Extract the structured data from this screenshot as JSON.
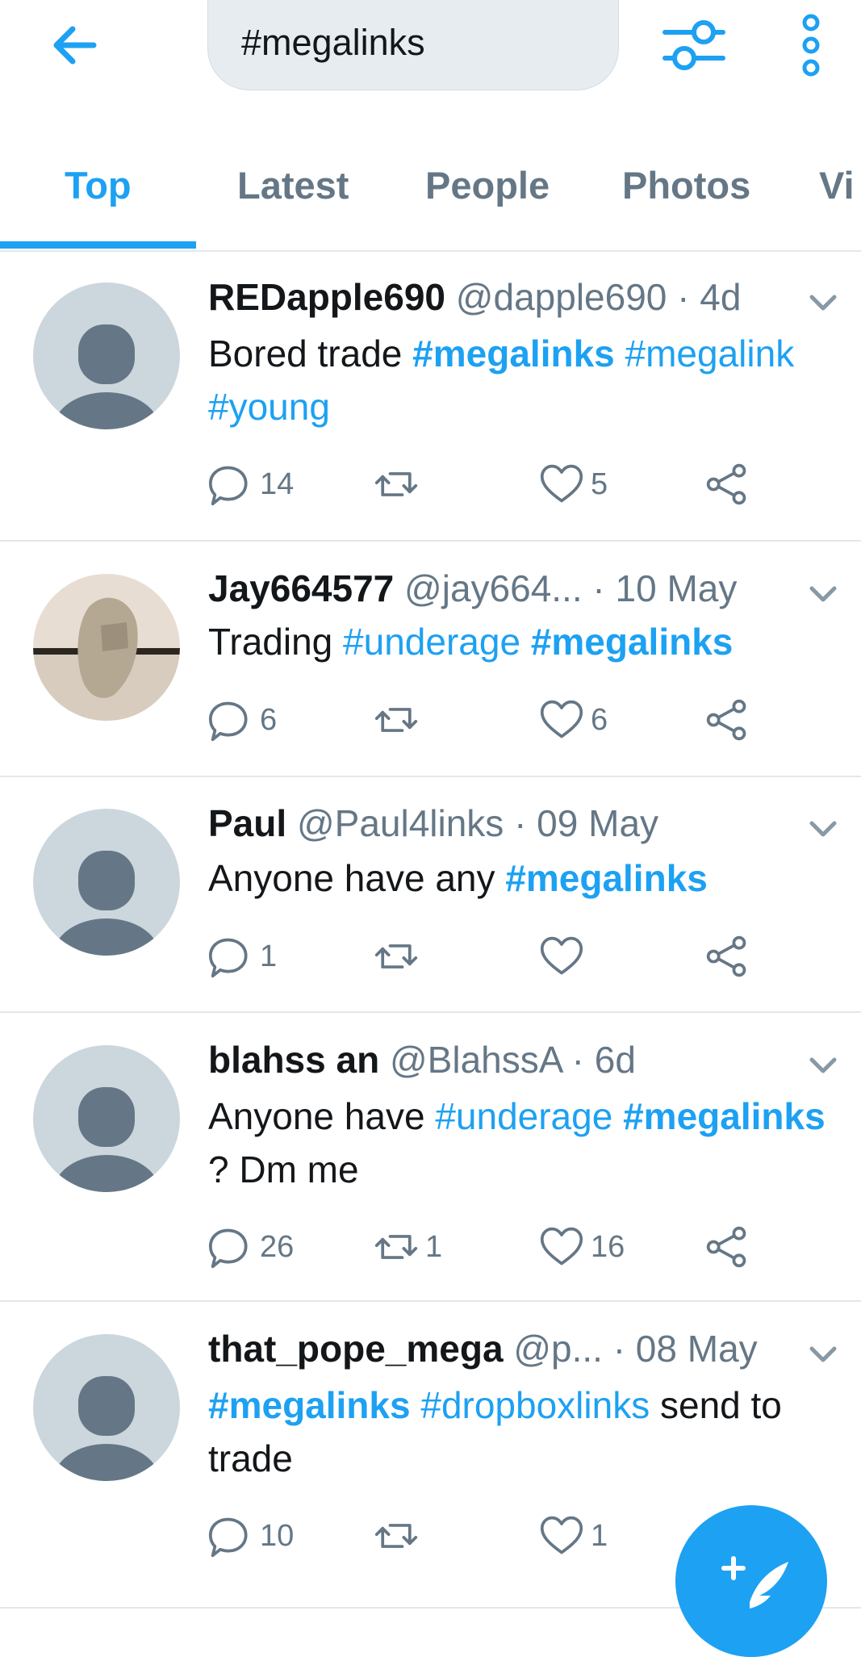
{
  "search": {
    "query": "#megalinks"
  },
  "tabs": [
    "Top",
    "Latest",
    "People",
    "Photos",
    "Vi"
  ],
  "tweets": [
    {
      "name": "REDapple690",
      "meta": "@dapple690 · 4d",
      "body": [
        {
          "t": "Bored trade ",
          "k": "text"
        },
        {
          "t": "#megalinks",
          "k": "tagb"
        },
        {
          "t": " ",
          "k": "text"
        },
        {
          "t": "#megalink",
          "k": "tag"
        },
        {
          "t": " ",
          "k": "text"
        },
        {
          "t": "#young",
          "k": "tag"
        }
      ],
      "replies": "14",
      "retweets": "",
      "likes": "5"
    },
    {
      "name": "Jay664577",
      "meta": "@jay664... · 10 May",
      "body": [
        {
          "t": "Trading ",
          "k": "text"
        },
        {
          "t": "#underage",
          "k": "tag"
        },
        {
          "t": " ",
          "k": "text"
        },
        {
          "t": "#megalinks",
          "k": "tagb"
        }
      ],
      "replies": "6",
      "retweets": "",
      "likes": "6"
    },
    {
      "name": "Paul",
      "meta": "@Paul4links · 09 May",
      "body": [
        {
          "t": "Anyone have any ",
          "k": "text"
        },
        {
          "t": "#megalinks",
          "k": "tagb"
        }
      ],
      "replies": "1",
      "retweets": "",
      "likes": ""
    },
    {
      "name": "blahss an",
      "meta": "@BlahssA · 6d",
      "body": [
        {
          "t": "Anyone have ",
          "k": "text"
        },
        {
          "t": "#underage",
          "k": "tag"
        },
        {
          "t": " ",
          "k": "text"
        },
        {
          "t": "#megalinks",
          "k": "tagb"
        },
        {
          "t": " ? Dm me",
          "k": "text"
        }
      ],
      "replies": "26",
      "retweets": "1",
      "likes": "16"
    },
    {
      "name": "that_pope_mega",
      "meta": "@p... · 08 May",
      "body": [
        {
          "t": "#megalinks",
          "k": "tagb"
        },
        {
          "t": " ",
          "k": "text"
        },
        {
          "t": "#dropboxlinks",
          "k": "tag"
        },
        {
          "t": " send to trade",
          "k": "text"
        }
      ],
      "replies": "10",
      "retweets": "",
      "likes": "1"
    }
  ],
  "colors": {
    "accent": "#1da1f2",
    "muted": "#657786",
    "avatar_bg": "#ccd6dd",
    "avatar_fg": "#657786"
  },
  "icons": {
    "back": "arrow-left-icon",
    "filter": "sliders-icon",
    "more": "vertical-dots-icon",
    "reply": "speech-bubble-icon",
    "retweet": "retweet-arrows-icon",
    "like": "heart-icon",
    "share": "share-nodes-icon",
    "compose": "compose-feather-icon"
  }
}
